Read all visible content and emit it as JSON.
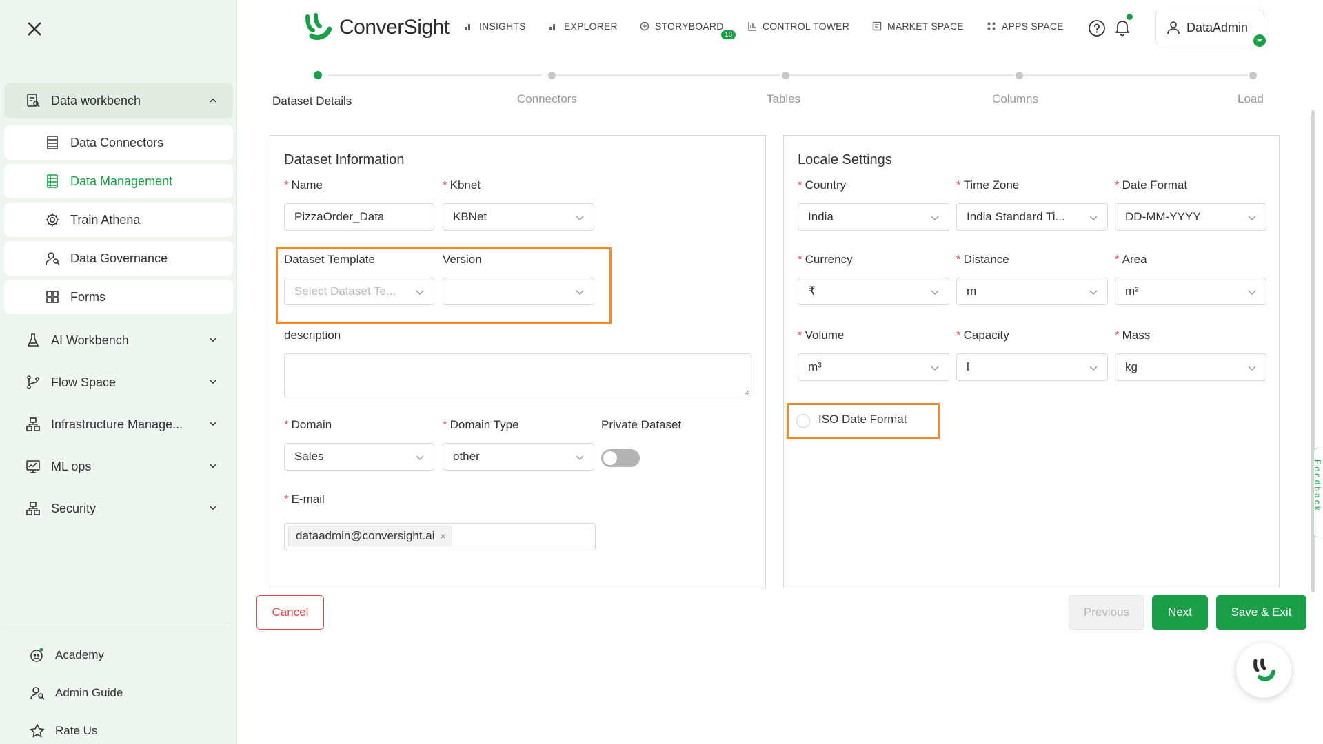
{
  "colors": {
    "accent": "#1a9e48",
    "highlight": "#f08a2a",
    "danger": "#e24b4b",
    "sidebar_bg": "#eef6ef"
  },
  "sidebar": {
    "close_icon": "close-icon",
    "group": {
      "label": "Data workbench",
      "icon": "data-workbench-icon",
      "expanded": true
    },
    "sub_items": [
      {
        "label": "Data Connectors",
        "icon": "data-connectors-icon",
        "active": false
      },
      {
        "label": "Data Management",
        "icon": "data-management-icon",
        "active": true
      },
      {
        "label": "Train Athena",
        "icon": "gear-icon",
        "active": false
      },
      {
        "label": "Data Governance",
        "icon": "governance-icon",
        "active": false
      },
      {
        "label": "Forms",
        "icon": "forms-icon",
        "active": false
      }
    ],
    "items": [
      {
        "label": "AI Workbench",
        "icon": "flask-icon"
      },
      {
        "label": "Flow Space",
        "icon": "flow-icon"
      },
      {
        "label": "Infrastructure Manage...",
        "icon": "infrastructure-icon"
      },
      {
        "label": "ML ops",
        "icon": "ml-ops-icon"
      },
      {
        "label": "Security",
        "icon": "security-icon"
      }
    ],
    "bottom": [
      {
        "label": "Academy",
        "icon": "academy-icon"
      },
      {
        "label": "Admin Guide",
        "icon": "admin-guide-icon"
      },
      {
        "label": "Rate Us",
        "icon": "star-icon"
      }
    ]
  },
  "topbar": {
    "logo_text": "ConverSight",
    "menu": [
      {
        "label": "INSIGHTS",
        "icon": "bar-chart-icon"
      },
      {
        "label": "EXPLORER",
        "icon": "bar-chart-icon"
      },
      {
        "label": "STORYBOARD",
        "icon": "storyboard-icon"
      },
      {
        "label": "CONTROL TOWER",
        "icon": "control-tower-icon"
      },
      {
        "label": "MARKET SPACE",
        "icon": "market-space-icon"
      },
      {
        "label": "APPS SPACE",
        "icon": "apps-space-icon"
      }
    ],
    "storyboard_badge": "18",
    "user": "DataAdmin"
  },
  "stepper": {
    "steps": [
      "Dataset Details",
      "Connectors",
      "Tables",
      "Columns",
      "Load"
    ],
    "active_index": 0
  },
  "dataset_info": {
    "title": "Dataset Information",
    "name_label": "Name",
    "name_value": "PizzaOrder_Data",
    "kbnet_label": "Kbnet",
    "kbnet_value": "KBNet",
    "template_label": "Dataset Template",
    "template_placeholder": "Select Dataset Te...",
    "version_label": "Version",
    "version_value": "",
    "description_label": "description",
    "domain_label": "Domain",
    "domain_value": "Sales",
    "domain_type_label": "Domain Type",
    "domain_type_value": "other",
    "private_label": "Private Dataset",
    "private_value": false,
    "email_label": "E-mail",
    "email_tag": "dataadmin@conversight.ai",
    "email_tag_remove": "×"
  },
  "locale": {
    "title": "Locale Settings",
    "country_label": "Country",
    "country_value": "India",
    "timezone_label": "Time Zone",
    "timezone_value": "India Standard Ti...",
    "date_format_label": "Date Format",
    "date_format_value": "DD-MM-YYYY",
    "currency_label": "Currency",
    "currency_value": "₹",
    "distance_label": "Distance",
    "distance_value": "m",
    "area_label": "Area",
    "area_value": "m²",
    "volume_label": "Volume",
    "volume_value": "m³",
    "capacity_label": "Capacity",
    "capacity_value": "l",
    "mass_label": "Mass",
    "mass_value": "kg",
    "iso_label": "ISO Date Format",
    "iso_checked": false
  },
  "required_mark": "*",
  "buttons": {
    "cancel": "Cancel",
    "previous": "Previous",
    "next": "Next",
    "save_exit": "Save & Exit"
  },
  "feedback_label": "Feedback"
}
